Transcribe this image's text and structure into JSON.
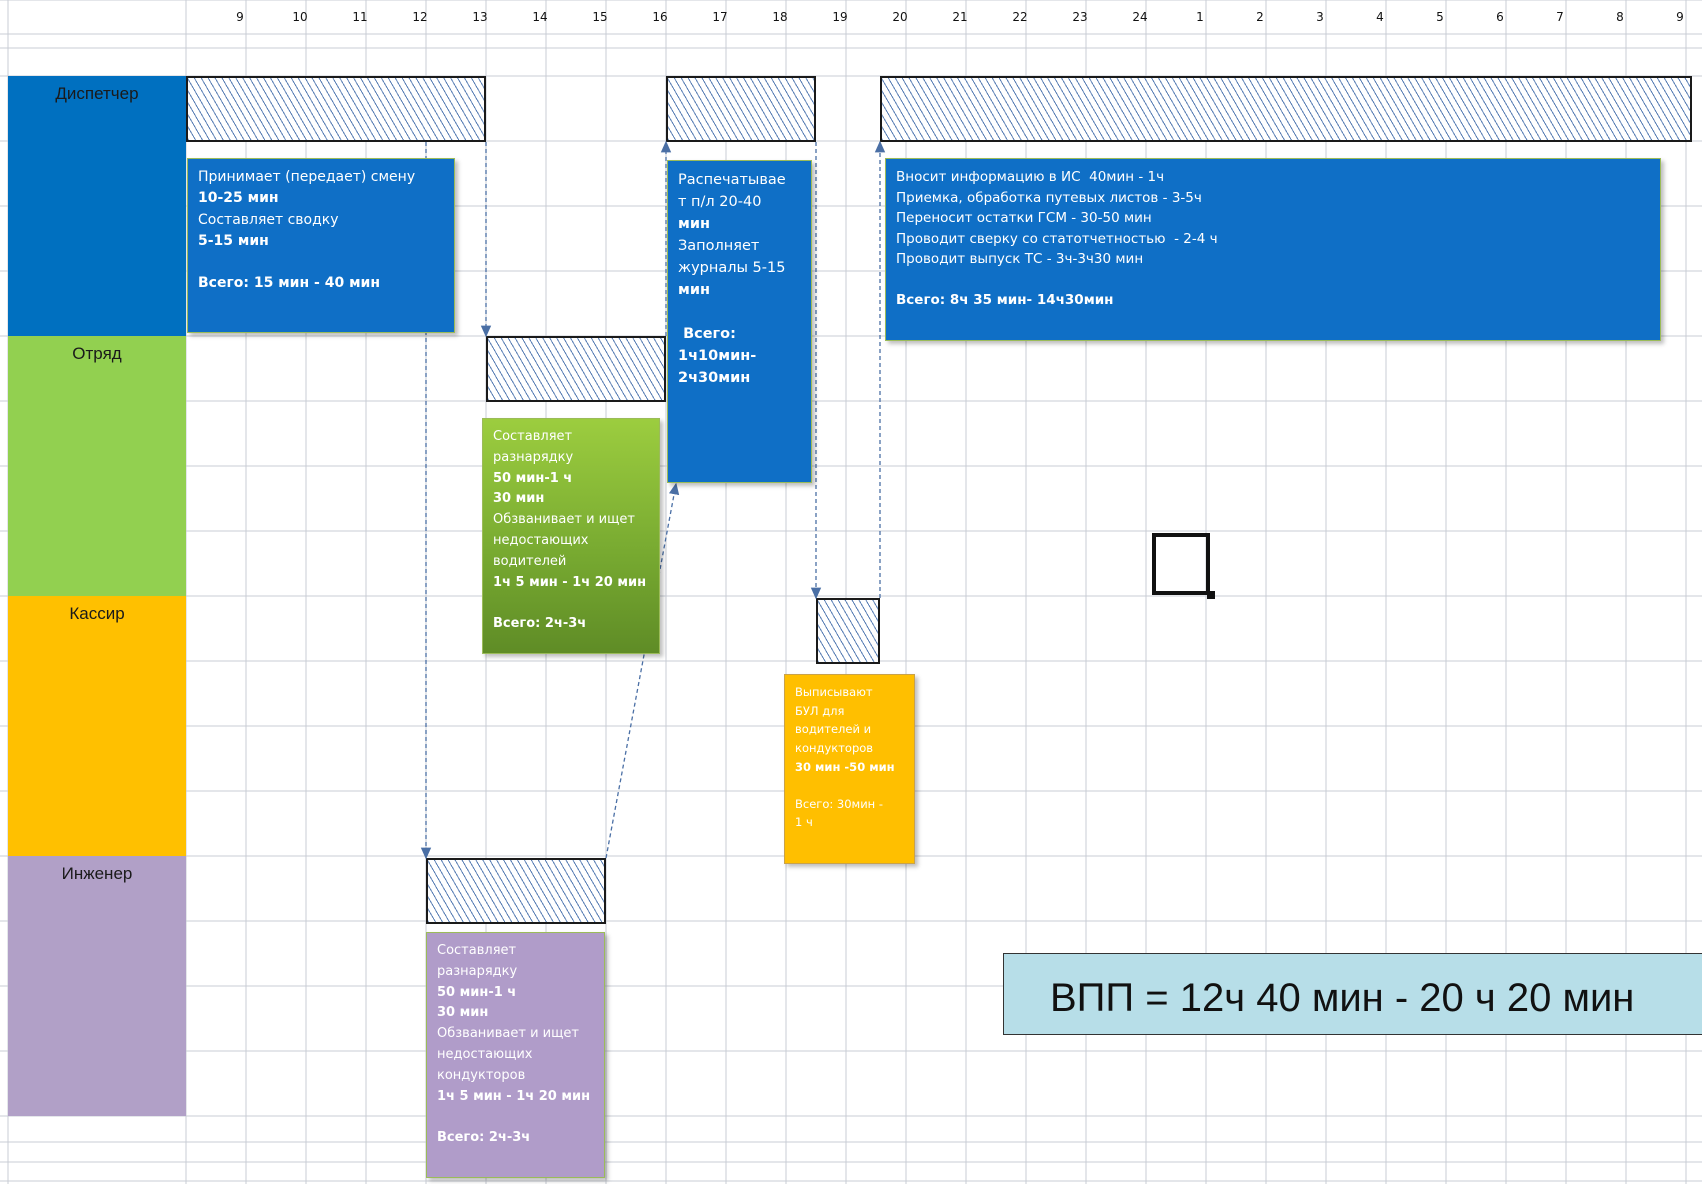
{
  "timeline": {
    "hours": [
      "9",
      "10",
      "11",
      "12",
      "13",
      "14",
      "15",
      "16",
      "17",
      "18",
      "19",
      "20",
      "21",
      "22",
      "23",
      "24",
      "1",
      "2",
      "3",
      "4",
      "5",
      "6",
      "7",
      "8",
      "9"
    ]
  },
  "lanes": [
    {
      "label": "Диспетчер",
      "color": "#0070c0"
    },
    {
      "label": "Отряд",
      "color": "#92d050"
    },
    {
      "label": "Кассир",
      "color": "#ffc000"
    },
    {
      "label": "Инженер",
      "color": "#b1a0c7"
    }
  ],
  "notes": {
    "dispatcher_shift": {
      "lines": [
        {
          "text": "Принимает (передает) смену",
          "bold": false
        },
        {
          "text": "10-25 мин",
          "bold": true
        },
        {
          "text": "Составляет сводку",
          "bold": false
        },
        {
          "text": "5-15 мин",
          "bold": true
        },
        {
          "text": " ",
          "bold": false
        },
        {
          "text": "Всего: 15 мин - 40 мин",
          "bold": true
        }
      ]
    },
    "dispatcher_print": {
      "lines": [
        {
          "text": "Распечатывае",
          "bold": false
        },
        {
          "text": "т п/л 20-40",
          "bold": false,
          "bold_tail": "20-40"
        },
        {
          "text": "мин",
          "bold": true
        },
        {
          "text": "Заполняет",
          "bold": false
        },
        {
          "text": "журналы 5-15",
          "bold": false
        },
        {
          "text": "мин",
          "bold": true
        },
        {
          "text": " ",
          "bold": false
        },
        {
          "text": " Всего:",
          "bold": true
        },
        {
          "text": "1ч10мин-",
          "bold": true
        },
        {
          "text": "2ч30мин",
          "bold": true
        }
      ]
    },
    "dispatcher_evening": {
      "lines": [
        {
          "text": "Вносит информацию в ИС  40мин - 1ч",
          "bold": false
        },
        {
          "text": "Приемка, обработка путевых листов - 3-5ч",
          "bold": false
        },
        {
          "text": "Переносит остатки ГСМ - 30-50 мин",
          "bold": false
        },
        {
          "text": "Проводит сверку со статотчетностью  - 2-4 ч",
          "bold": false
        },
        {
          "text": "Проводит выпуск ТС - 3ч-3ч30 мин",
          "bold": false
        },
        {
          "text": " ",
          "bold": false
        },
        {
          "text": "Всего: 8ч 35 мин- 14ч30мин",
          "bold": true
        }
      ]
    },
    "detachment": {
      "lines": [
        {
          "text": "Составляет",
          "bold": false
        },
        {
          "text": "разнарядку",
          "bold": false
        },
        {
          "text": "50 мин-1 ч",
          "bold": true
        },
        {
          "text": "30 мин",
          "bold": true
        },
        {
          "text": "Обзванивает и ищет",
          "bold": false
        },
        {
          "text": "недостающих",
          "bold": false
        },
        {
          "text": "водителей",
          "bold": false
        },
        {
          "text": "1ч 5 мин - 1ч 20 мин",
          "bold": true
        },
        {
          "text": " ",
          "bold": false
        },
        {
          "text": "Всего: 2ч-3ч",
          "bold": true
        }
      ]
    },
    "cashier": {
      "lines": [
        {
          "text": "Выписывают",
          "bold": false
        },
        {
          "text": "БУЛ для",
          "bold": false
        },
        {
          "text": "водителей и",
          "bold": false
        },
        {
          "text": "кондукторов",
          "bold": false
        },
        {
          "text": "30 мин -50 мин",
          "bold": true
        },
        {
          "text": " ",
          "bold": false
        },
        {
          "text": "Всего: 30мин -",
          "bold": false
        },
        {
          "text": "1 ч",
          "bold": false
        }
      ]
    },
    "engineer": {
      "lines": [
        {
          "text": "Составляет",
          "bold": false
        },
        {
          "text": "разнарядку",
          "bold": false
        },
        {
          "text": "50 мин-1 ч",
          "bold": true
        },
        {
          "text": "30 мин",
          "bold": true
        },
        {
          "text": "Обзванивает и ищет",
          "bold": false
        },
        {
          "text": "недостающих",
          "bold": false
        },
        {
          "text": "кондукторов",
          "bold": false
        },
        {
          "text": "1ч 5 мин - 1ч 20 мин",
          "bold": true
        },
        {
          "text": " ",
          "bold": false
        },
        {
          "text": "Всего: 2ч-3ч",
          "bold": true
        }
      ]
    }
  },
  "summary": {
    "vpp": "ВПП = 12ч 40 мин - 20 ч 20 мин"
  },
  "colors": {
    "note_blue": "#0f6fc6",
    "grid_line": "#c8ccd4",
    "hatch": "#5a7fb5",
    "arrow": "#4a6fa5",
    "summary_bg": "#b7dee8"
  }
}
